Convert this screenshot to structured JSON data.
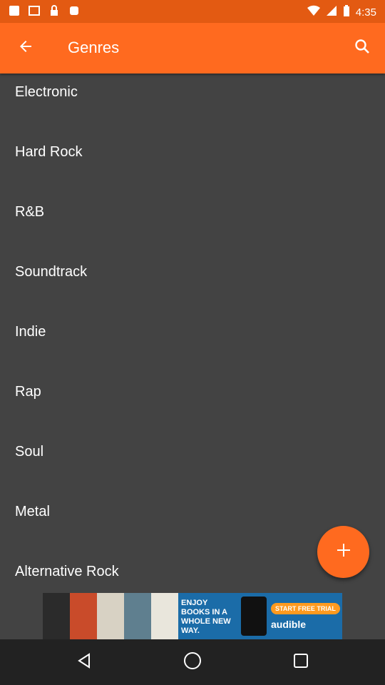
{
  "status_bar": {
    "time": "4:35",
    "icons_left": [
      "notification-icon",
      "image-icon",
      "lock-icon",
      "app-icon"
    ]
  },
  "app_bar": {
    "title": "Genres"
  },
  "genres": [
    {
      "label": "Electronic"
    },
    {
      "label": "Hard Rock"
    },
    {
      "label": "R&B"
    },
    {
      "label": "Soundtrack"
    },
    {
      "label": "Indie"
    },
    {
      "label": "Rap"
    },
    {
      "label": "Soul"
    },
    {
      "label": "Metal"
    },
    {
      "label": "Alternative Rock"
    }
  ],
  "ad": {
    "text": "ENJOY BOOKS IN A WHOLE NEW WAY.",
    "cta": "START FREE TRIAL",
    "brand": "audible"
  },
  "colors": {
    "accent": "#ff6a1f",
    "status": "#e35a12",
    "background": "#434343"
  }
}
